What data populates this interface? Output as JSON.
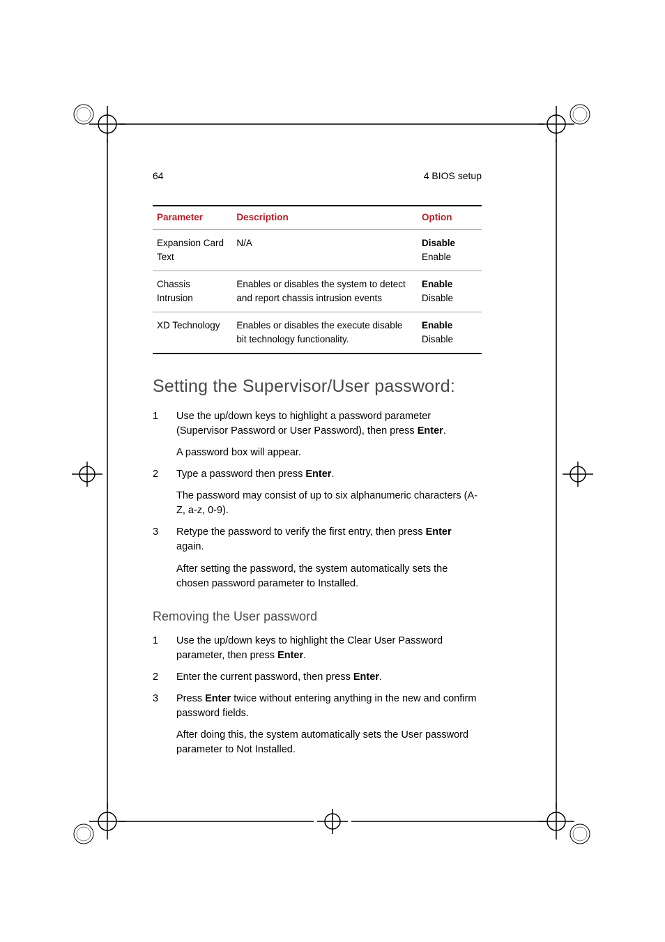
{
  "header": {
    "page_number": "64",
    "chapter": "4 BIOS setup"
  },
  "table": {
    "head": {
      "parameter": "Parameter",
      "description": "Description",
      "option": "Option"
    },
    "rows": [
      {
        "param": "Expansion Card Text",
        "desc": "N/A",
        "opt_bold": "Disable",
        "opt_plain": "Enable"
      },
      {
        "param": "Chassis Intrusion",
        "desc": "Enables or disables the system to detect and report chassis intrusion events",
        "opt_bold": "Enable",
        "opt_plain": "Disable"
      },
      {
        "param": "XD Technology",
        "desc": "Enables or disables the execute disable bit technology functionality.",
        "opt_bold": "Enable",
        "opt_plain": "Disable"
      }
    ]
  },
  "section1": {
    "title": "Setting the Supervisor/User password:",
    "steps": {
      "s1": {
        "num": "1",
        "p1a": "Use the up/down keys to highlight a password parameter (Supervisor Password or User Password), then press ",
        "p1b": "Enter",
        "p1c": ".",
        "p2": "A password box will appear."
      },
      "s2": {
        "num": "2",
        "p1a": "Type a password then press ",
        "p1b": "Enter",
        "p1c": ".",
        "p2": "The password may consist of up to six alphanumeric characters (A-Z, a-z, 0-9)."
      },
      "s3": {
        "num": "3",
        "p1a": "Retype the password to verify the first entry, then press ",
        "p1b": "Enter",
        "p1c": " again.",
        "p2": "After setting the password, the system automatically sets the chosen password parameter to Installed."
      }
    }
  },
  "section2": {
    "title": "Removing the User password",
    "steps": {
      "s1": {
        "num": "1",
        "p1a": "Use the up/down keys to highlight the Clear User Password parameter, then press ",
        "p1b": "Enter",
        "p1c": "."
      },
      "s2": {
        "num": "2",
        "p1a": "Enter the current password, then press ",
        "p1b": "Enter",
        "p1c": "."
      },
      "s3": {
        "num": "3",
        "p1a": "Press ",
        "p1b": "Enter",
        "p1c": " twice without entering anything in the new and confirm password fields.",
        "p2": "After doing this, the system automatically sets the User password parameter to Not Installed."
      }
    }
  }
}
